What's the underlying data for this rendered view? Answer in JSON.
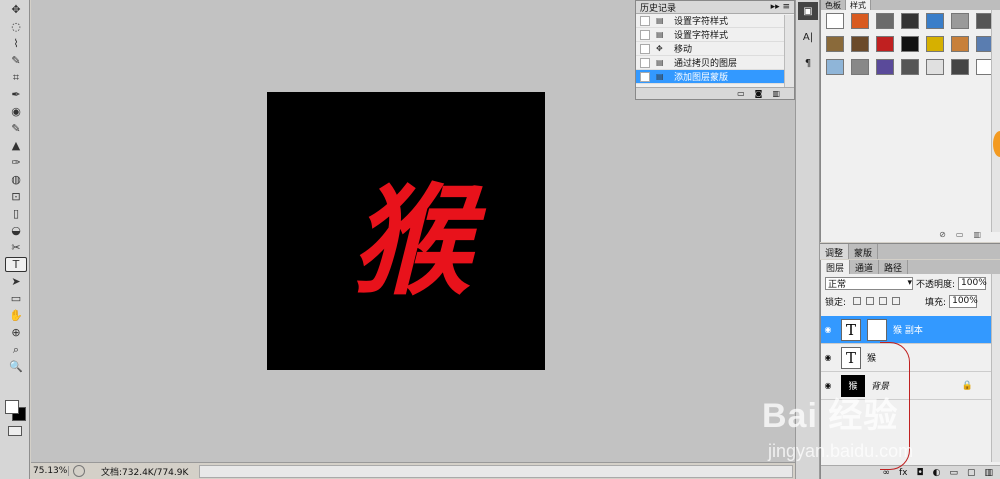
{
  "toolbox": {
    "tools": [
      "✥",
      "◌",
      "⌇",
      "✎",
      "⌗",
      "✒",
      "◉",
      "✎",
      "▲",
      "✑",
      "◍",
      "⊡",
      "▯",
      "◒",
      "✂",
      "T",
      "➤",
      "▭",
      "✋",
      "⊕",
      "⌕",
      "🔍"
    ]
  },
  "canvas": {
    "glyph": "猴",
    "glyph_color": "#e8121b",
    "background": "#000000"
  },
  "status": {
    "zoom": "75.13%",
    "docsize": "文档:732.4K/774.9K"
  },
  "history": {
    "title": "历史记录",
    "menu": "▸▸ ≡",
    "items": [
      {
        "label": "设置字符样式",
        "selected": false
      },
      {
        "label": "设置字符样式",
        "selected": false
      },
      {
        "label": "移动",
        "selected": false
      },
      {
        "label": "通过拷贝的图层",
        "selected": false
      },
      {
        "label": "添加图层蒙版",
        "selected": true
      }
    ]
  },
  "dock": {
    "icons": [
      "▣",
      "A|",
      "¶"
    ]
  },
  "styles_panel": {
    "tabs": [
      "色板",
      "样式"
    ],
    "swatches": [
      "#ffffff",
      "#d85a20",
      "#6b6b6b",
      "#333333",
      "#3a7ec9",
      "#9a9a9a",
      "#555555",
      "#8a6a3a",
      "#6b4a2a",
      "#c02020",
      "#111111",
      "#d6b000",
      "#c8803a",
      "#5a7db0",
      "#8fb5d8",
      "#888888",
      "#5a4a9a",
      "#555555",
      "#e0e0e0",
      "#444444",
      "#ffffff"
    ]
  },
  "adjust_tabs": [
    "调整",
    "蒙版"
  ],
  "layers_panel": {
    "tabs": [
      "图层",
      "通道",
      "路径"
    ],
    "blend_mode": "正常",
    "opacity_label": "不透明度:",
    "opacity": "100%",
    "lock_label": "锁定:",
    "fill_label": "填充:",
    "fill": "100%",
    "layers": [
      {
        "name": "猴 副本",
        "thumb": "T",
        "selected": true
      },
      {
        "name": "猴",
        "thumb": "T",
        "selected": false
      },
      {
        "name": "背景",
        "thumb": "猴",
        "selected": false
      }
    ]
  },
  "watermark": {
    "line1": "Bai  经验",
    "line2": "jingyan.baidu.com"
  }
}
